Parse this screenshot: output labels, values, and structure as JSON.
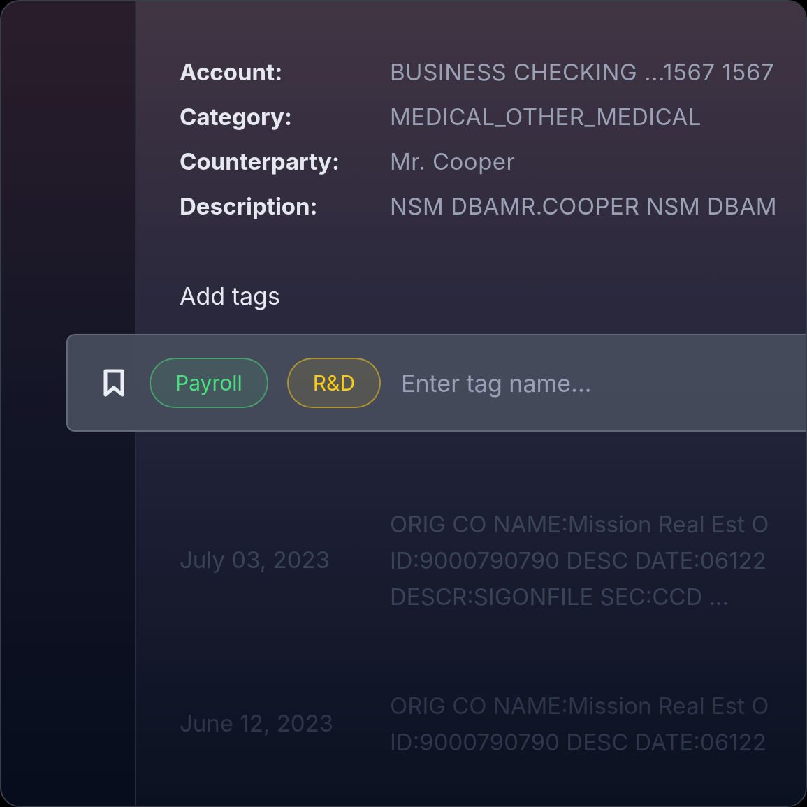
{
  "details": [
    {
      "label": "Account:",
      "value": "BUSINESS CHECKING ...1567 1567"
    },
    {
      "label": "Category:",
      "value": "MEDICAL_OTHER_MEDICAL"
    },
    {
      "label": "Counterparty:",
      "value": "Mr. Cooper"
    },
    {
      "label": "Description:",
      "value": "NSM DBAMR.COOPER NSM DBAM"
    }
  ],
  "add_tags": {
    "title": "Add tags",
    "tags": [
      {
        "label": "Payroll",
        "color": "#4ade80"
      },
      {
        "label": "R&D",
        "color": "#facc15"
      }
    ],
    "placeholder": "Enter tag name..."
  },
  "transactions": [
    {
      "date": "July 03, 2023",
      "description": [
        "ORIG CO NAME:Mission Real Est O",
        "ID:9000790790 DESC DATE:06122",
        "DESCR:SIGONFILE SEC:CCD ..."
      ]
    },
    {
      "date": "June 12, 2023",
      "description": [
        "ORIG CO NAME:Mission Real Est O",
        "ID:9000790790 DESC DATE:06122"
      ]
    }
  ]
}
